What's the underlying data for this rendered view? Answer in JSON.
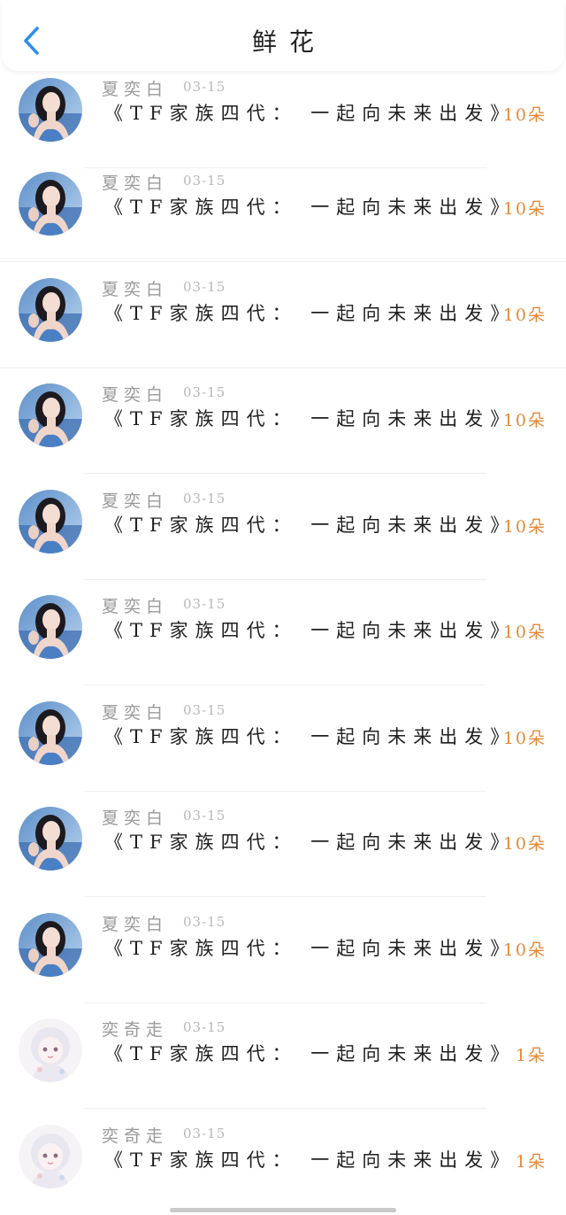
{
  "header": {
    "title": "鲜花",
    "back_icon": "chevron-left-icon",
    "accent": "#2f8ee8"
  },
  "colors": {
    "quantity": "#e4893a"
  },
  "gifts": [
    {
      "name": "夏奕白",
      "date": "03-15",
      "title": "《TF家族四代： 一起向未来出发》",
      "quantity": "10朵",
      "avatar": "photo-avatar"
    },
    {
      "name": "夏奕白",
      "date": "03-15",
      "title": "《TF家族四代： 一起向未来出发》",
      "quantity": "10朵",
      "avatar": "photo-avatar"
    },
    {
      "name": "夏奕白",
      "date": "03-15",
      "title": "《TF家族四代： 一起向未来出发》",
      "quantity": "10朵",
      "avatar": "photo-avatar"
    },
    {
      "name": "夏奕白",
      "date": "03-15",
      "title": "《TF家族四代： 一起向未来出发》",
      "quantity": "10朵",
      "avatar": "photo-avatar"
    },
    {
      "name": "夏奕白",
      "date": "03-15",
      "title": "《TF家族四代： 一起向未来出发》",
      "quantity": "10朵",
      "avatar": "photo-avatar"
    },
    {
      "name": "夏奕白",
      "date": "03-15",
      "title": "《TF家族四代： 一起向未来出发》",
      "quantity": "10朵",
      "avatar": "photo-avatar"
    },
    {
      "name": "夏奕白",
      "date": "03-15",
      "title": "《TF家族四代： 一起向未来出发》",
      "quantity": "10朵",
      "avatar": "photo-avatar"
    },
    {
      "name": "夏奕白",
      "date": "03-15",
      "title": "《TF家族四代： 一起向未来出发》",
      "quantity": "10朵",
      "avatar": "photo-avatar"
    },
    {
      "name": "夏奕白",
      "date": "03-15",
      "title": "《TF家族四代： 一起向未来出发》",
      "quantity": "10朵",
      "avatar": "photo-avatar"
    },
    {
      "name": "奕奇走",
      "date": "03-15",
      "title": "《TF家族四代： 一起向未来出发》",
      "quantity": "1朵",
      "avatar": "anime-avatar"
    },
    {
      "name": "奕奇走",
      "date": "03-15",
      "title": "《TF家族四代： 一起向未来出发》",
      "quantity": "1朵",
      "avatar": "anime-avatar"
    }
  ]
}
